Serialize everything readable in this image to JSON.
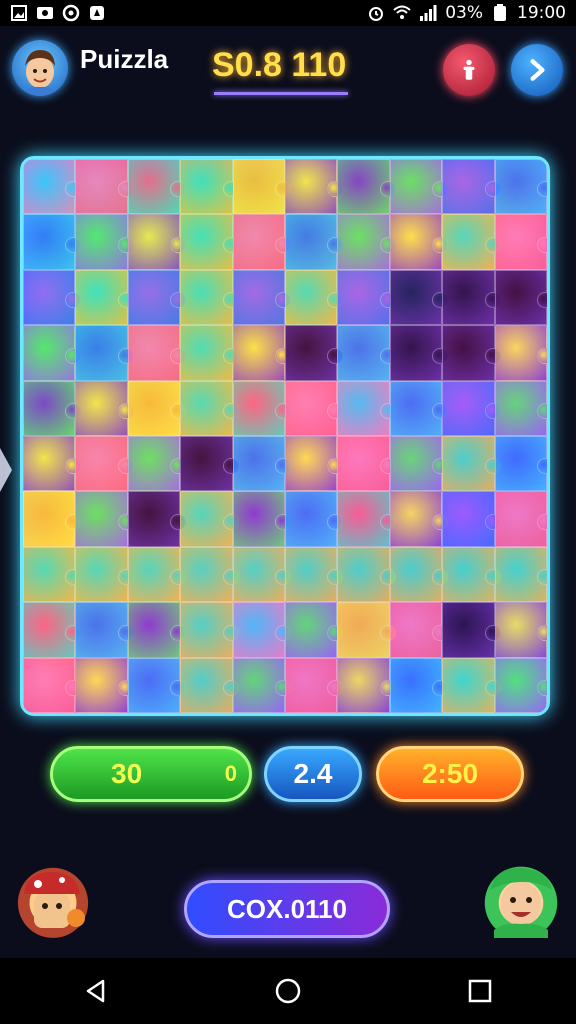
{
  "status_bar": {
    "battery_percent_text": "03%",
    "time": "19:00",
    "icons": [
      "gallery-icon",
      "photo-icon",
      "sync-icon",
      "location-icon",
      "alarm-icon",
      "wifi-icon",
      "signal-icon",
      "battery-icon"
    ]
  },
  "header": {
    "title": "Puizzla",
    "score": "S0.8 110",
    "hint_icon": "info-icon",
    "next_icon": "chevron-right-icon"
  },
  "board": {
    "columns": 10,
    "rows": 10,
    "colors": {
      "frame_glow": "#6ee8ff",
      "accent_purple": "#9d5cff"
    }
  },
  "stats": {
    "moves": "30",
    "moves_sub": "0",
    "level": "2.4",
    "timer": "2:50"
  },
  "bottom": {
    "action_label": "COX.0110",
    "left_mascot": "mushroom-character",
    "right_mascot": "elf-character"
  },
  "nav_bar": {
    "icons": [
      "back-icon",
      "home-icon",
      "recents-icon"
    ]
  }
}
